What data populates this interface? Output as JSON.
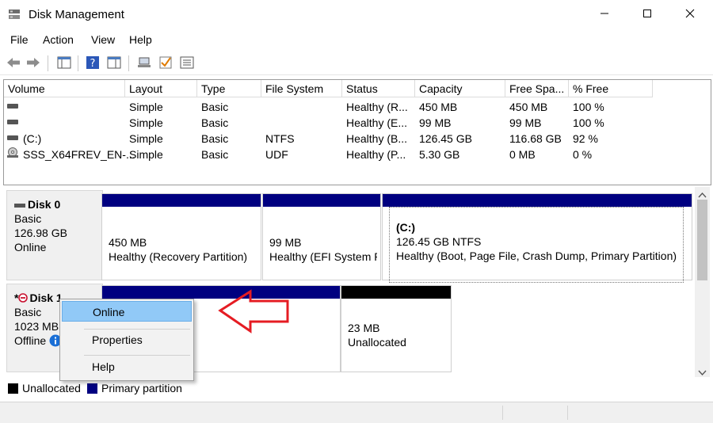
{
  "window": {
    "title": "Disk Management",
    "minimize_icon": "minimize-icon",
    "maximize_icon": "maximize-icon",
    "close_icon": "close-icon"
  },
  "menu": {
    "items": [
      "File",
      "Action",
      "View",
      "Help"
    ]
  },
  "toolbar": {
    "icons": [
      "back-arrow-icon",
      "forward-arrow-icon",
      "console-tree-icon",
      "help-icon",
      "properties-icon",
      "connect-icon",
      "check-icon",
      "settings-list-icon"
    ]
  },
  "volume_table": {
    "columns": [
      "Volume",
      "Layout",
      "Type",
      "File System",
      "Status",
      "Capacity",
      "Free Spa...",
      "% Free"
    ],
    "rows": [
      {
        "volume": "",
        "layout": "Simple",
        "type": "Basic",
        "fs": "",
        "status": "Healthy (R...",
        "capacity": "450 MB",
        "free": "450 MB",
        "pct": "100 %"
      },
      {
        "volume": "",
        "layout": "Simple",
        "type": "Basic",
        "fs": "",
        "status": "Healthy (E...",
        "capacity": "99 MB",
        "free": "99 MB",
        "pct": "100 %"
      },
      {
        "volume": "(C:)",
        "layout": "Simple",
        "type": "Basic",
        "fs": "NTFS",
        "status": "Healthy (B...",
        "capacity": "126.45 GB",
        "free": "116.68 GB",
        "pct": "92 %"
      },
      {
        "volume": "SSS_X64FREV_EN-...",
        "layout": "Simple",
        "type": "Basic",
        "fs": "UDF",
        "status": "Healthy (P...",
        "capacity": "5.30 GB",
        "free": "0 MB",
        "pct": "0 %"
      }
    ]
  },
  "disks": [
    {
      "name": "Disk 0",
      "kind": "Basic",
      "size": "126.98 GB",
      "state": "Online",
      "partitions": [
        {
          "title": "",
          "size": "450 MB",
          "status": "Healthy (Recovery Partition)"
        },
        {
          "title": "",
          "size": "99 MB",
          "status": "Healthy (EFI System P"
        },
        {
          "title": "(C:)",
          "size": "126.45 GB NTFS",
          "status": "Healthy (Boot, Page File, Crash Dump, Primary Partition)"
        }
      ]
    },
    {
      "name": "Disk 1",
      "prefix": "*",
      "kind": "Basic",
      "size": "1023 MB",
      "state": "Offline",
      "partitions": [
        {
          "size": "",
          "status": ""
        },
        {
          "size": "23 MB",
          "status": "Unallocated"
        }
      ]
    }
  ],
  "legend": [
    {
      "label": "Unallocated",
      "color": "#000000"
    },
    {
      "label": "Primary partition",
      "color": "#000080"
    }
  ],
  "context_menu": {
    "items": [
      "Online",
      "Properties",
      "Help"
    ],
    "highlighted": "Online"
  },
  "colors": {
    "primary_partition": "#000080",
    "unallocated": "#000000",
    "arrow": "#e51c23",
    "info": "#1a6fd6"
  }
}
